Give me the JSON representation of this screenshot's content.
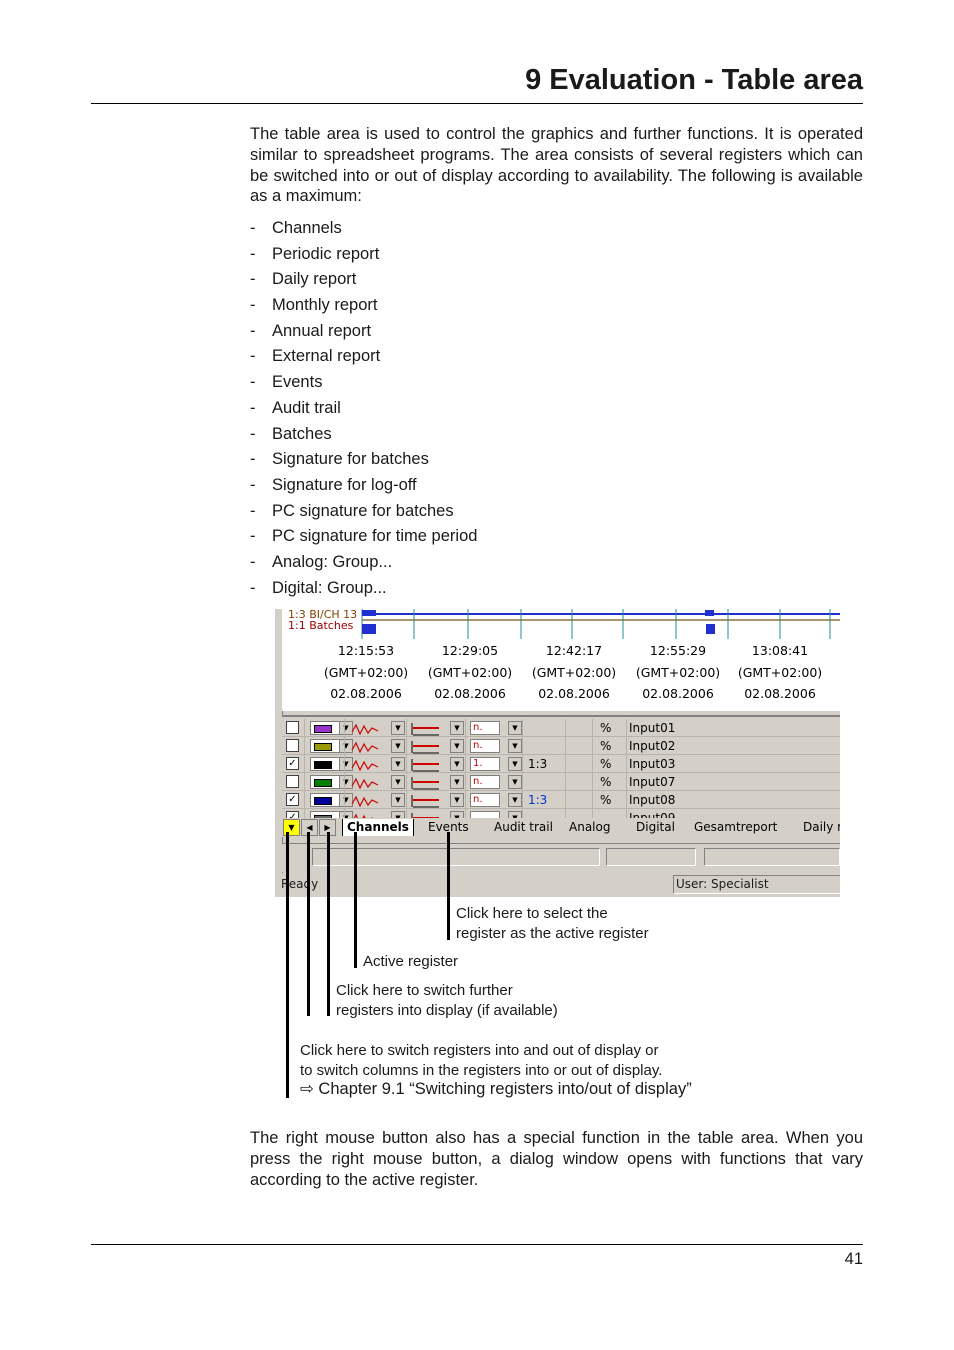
{
  "header": {
    "title": "9 Evaluation - Table area"
  },
  "intro": "The table area is used to control the graphics and further functions. It is operated similar to spreadsheet programs. The area consists of several registers which can be switched into or out of display according to availability. The following is available as a maximum:",
  "registers": [
    "Channels",
    "Periodic report",
    "Daily report",
    "Monthly report",
    "Annual report",
    "External report",
    "Events",
    "Audit trail",
    "Batches",
    "Signature for batches",
    "Signature for log-off",
    "PC signature for batches",
    "PC signature for time period",
    "Analog: Group...",
    "Digital: Group..."
  ],
  "list_dash": "-",
  "screenshot": {
    "trace_labels": [
      "1:3 BI/CH 13",
      "1:1 Batches"
    ],
    "time_axis": [
      {
        "time": "12:15:53",
        "tz": "(GMT+02:00)",
        "date": "02.08.2006"
      },
      {
        "time": "12:29:05",
        "tz": "(GMT+02:00)",
        "date": "02.08.2006"
      },
      {
        "time": "12:42:17",
        "tz": "(GMT+02:00)",
        "date": "02.08.2006"
      },
      {
        "time": "12:55:29",
        "tz": "(GMT+02:00)",
        "date": "02.08.2006"
      },
      {
        "time": "13:08:41",
        "tz": "(GMT+02:00)",
        "date": "02.08.2006"
      }
    ],
    "channels": [
      {
        "checked": false,
        "color": "#9933cc",
        "scale": "",
        "scale_color": "#000000",
        "unit": "%",
        "name": "Input01",
        "n": "n."
      },
      {
        "checked": false,
        "color": "#999900",
        "scale": "",
        "scale_color": "#000000",
        "unit": "%",
        "name": "Input02",
        "n": "n."
      },
      {
        "checked": true,
        "color": "#000000",
        "scale": "1:3",
        "scale_color": "#000000",
        "unit": "%",
        "name": "Input03",
        "n": "1."
      },
      {
        "checked": false,
        "color": "#008000",
        "scale": "",
        "scale_color": "#000000",
        "unit": "%",
        "name": "Input07",
        "n": "n."
      },
      {
        "checked": true,
        "color": "#000099",
        "scale": "1:3",
        "scale_color": "#0033cc",
        "unit": "%",
        "name": "Input08",
        "n": "n."
      },
      {
        "checked": true,
        "color": "#666666",
        "scale": "",
        "scale_color": "#000000",
        "unit": "",
        "name": "Input09",
        "n": ""
      }
    ],
    "check_mark": "✓",
    "tabs": [
      "Channels",
      "Events",
      "Audit trail",
      "Analog",
      "Digital",
      "Gesamtreport",
      "Daily r"
    ],
    "active_tab": "Channels",
    "status_ready": "Ready",
    "status_user": "User: Specialist"
  },
  "callouts": {
    "select_register": [
      "Click here to select the",
      "register as the active register"
    ],
    "active_register": "Active register",
    "switch_further": [
      "Click here to switch further",
      "registers into display (if available)"
    ],
    "switch_in_out": [
      "Click here to switch registers into and out of display or",
      "to switch columns in the registers into or out of display."
    ],
    "chapter_arrow": "⇨",
    "chapter_ref": "Chapter 9.1 “Switching registers into/out of display”"
  },
  "outro": "The right mouse button also has a special function in the table area. When you press the right mouse button, a dialog window opens with functions that vary according to the active register.",
  "footer": {
    "page_number": "41"
  }
}
